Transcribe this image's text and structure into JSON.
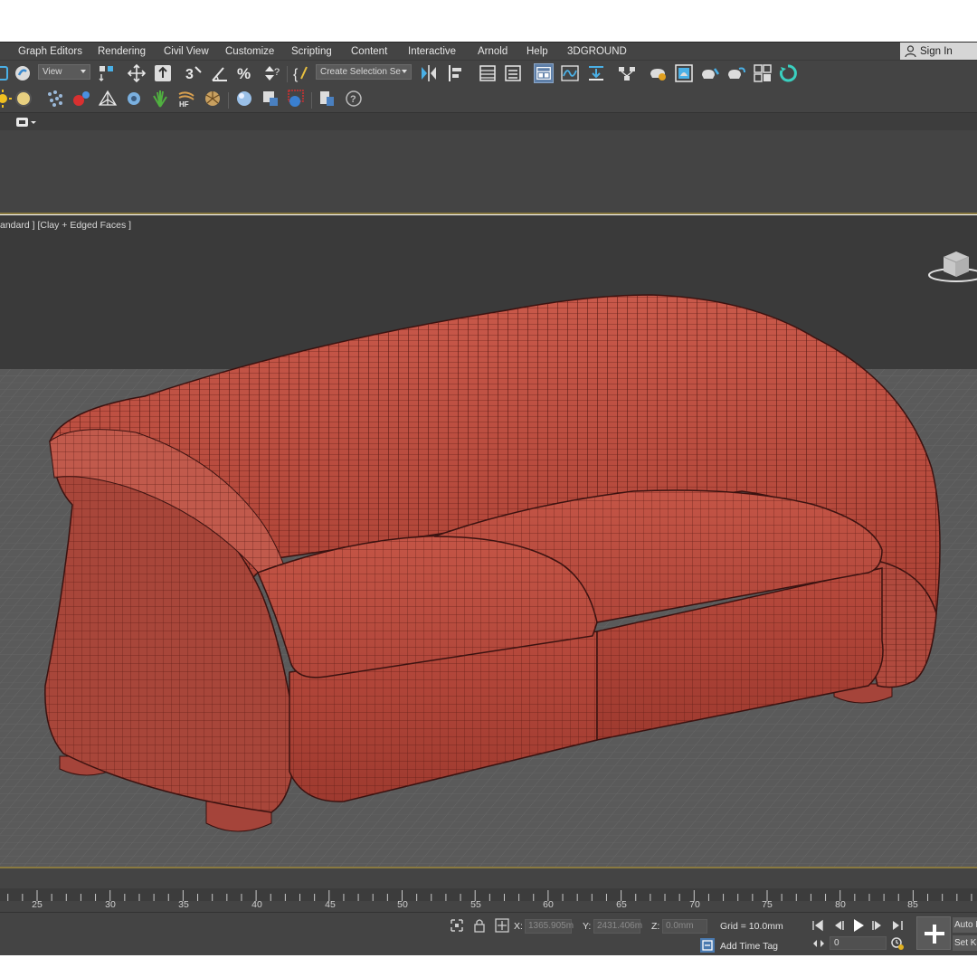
{
  "menu": {
    "items": [
      "Graph Editors",
      "Rendering",
      "Civil View",
      "Customize",
      "Scripting",
      "Content",
      "Interactive",
      "Arnold",
      "Help",
      "3DGROUND"
    ],
    "sign_in": "Sign In"
  },
  "toolbar": {
    "reference_coord_value": "View",
    "named_selection_placeholder": "Create Selection Se",
    "icons": [
      "select-link-icon",
      "bind-space-warp-icon",
      "selection-filter-icon",
      "select-move-icon",
      "select-place-icon",
      "snaps-toggle-icon",
      "angle-snap-icon",
      "percent-snap-icon",
      "spinner-snap-icon",
      "edit-named-selections-icon",
      "mirror-icon",
      "align-icon",
      "scene-explorer-icon",
      "layer-explorer-icon",
      "toggle-ribbon-icon",
      "curve-editor-icon",
      "dope-sheet-icon",
      "schematic-view-icon",
      "material-editor-icon",
      "render-setup-icon",
      "rendered-frame-window-icon",
      "render-production-icon",
      "render-iterative-icon",
      "arnold-render-icon"
    ]
  },
  "toolbar2": {
    "icons": [
      "sun-light-icon",
      "sphere-light-icon",
      "scatter-icon",
      "molecule-icon",
      "pyramid-icon",
      "gear-cluster-icon",
      "grass-icon",
      "hair-fur-icon",
      "shell-icon",
      "material-sphere-icon",
      "render-to-texture-icon",
      "environment-icon",
      "asset-tracking-icon",
      "help-icon"
    ]
  },
  "viewport": {
    "label": "andard ] [Clay + Edged Faces ]",
    "model_color": "#b5473a",
    "grid_color": "#6a6a6a"
  },
  "timeline": {
    "ticks": [
      "25",
      "30",
      "35",
      "40",
      "45",
      "50",
      "55",
      "60",
      "65",
      "70",
      "75",
      "80",
      "85"
    ]
  },
  "status": {
    "x_label": "X:",
    "x_value": "1365.905m",
    "y_label": "Y:",
    "y_value": "2431.406m",
    "z_label": "Z:",
    "z_value": "0.0mm",
    "grid": "Grid = 10.0mm",
    "add_time_tag": "Add Time Tag",
    "frame_value": "0",
    "auto_key": "Auto Key",
    "set_key": "Set Key"
  },
  "accent_color": "#8a7a40"
}
